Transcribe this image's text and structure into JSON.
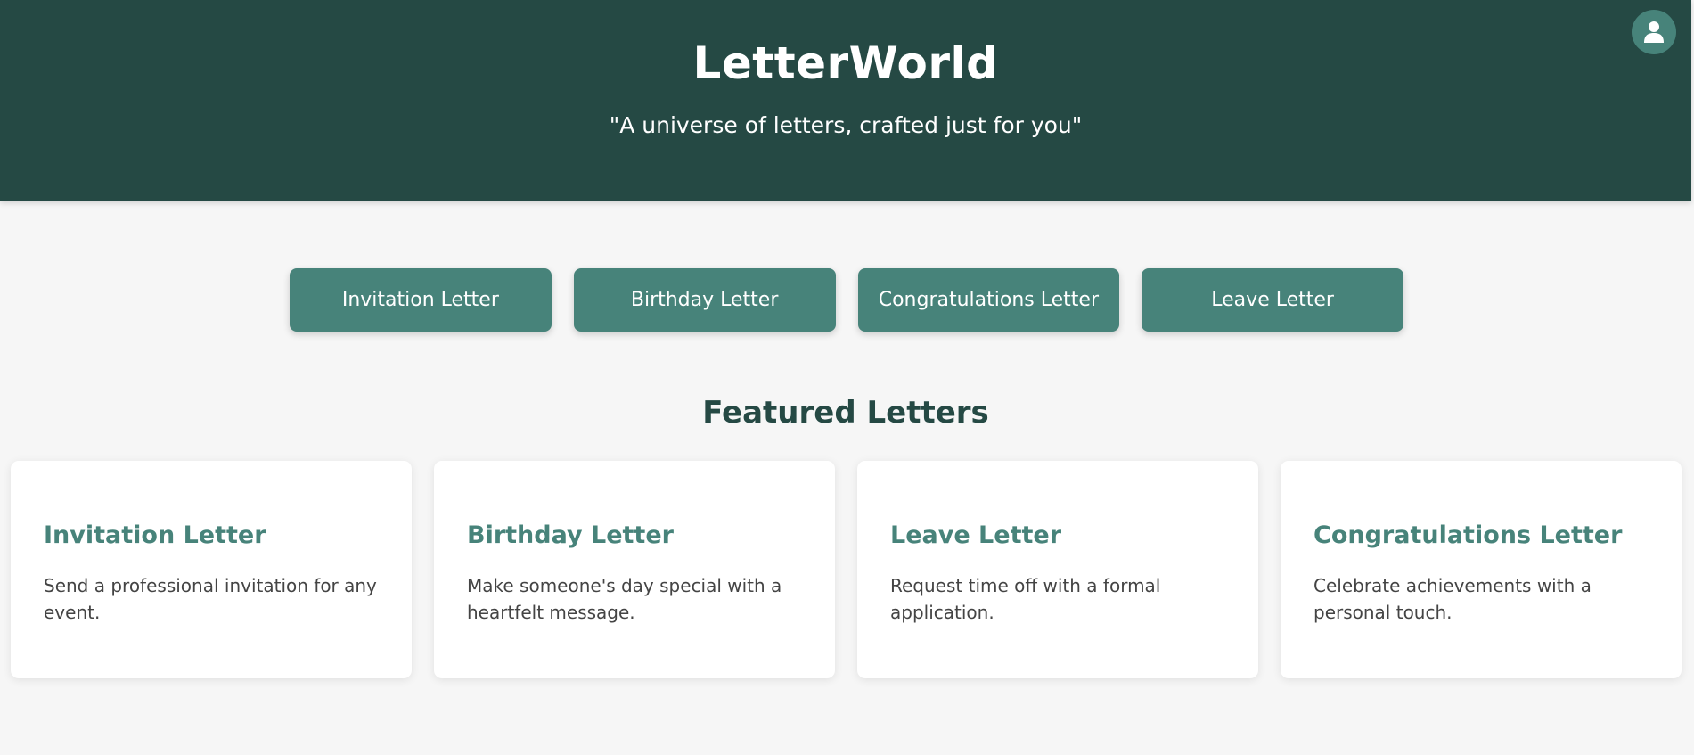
{
  "header": {
    "title": "LetterWorld",
    "tagline": "\"A universe of letters, crafted just for you\"",
    "profile_icon": "user-icon"
  },
  "nav": {
    "buttons": [
      {
        "label": "Invitation Letter"
      },
      {
        "label": "Birthday Letter"
      },
      {
        "label": "Congratulations Letter"
      },
      {
        "label": "Leave Letter"
      }
    ]
  },
  "featured": {
    "title": "Featured Letters",
    "cards": [
      {
        "title": "Invitation Letter",
        "description": "Send a professional invitation for any event."
      },
      {
        "title": "Birthday Letter",
        "description": "Make someone's day special with a heartfelt message."
      },
      {
        "title": "Leave Letter",
        "description": "Request time off with a formal application."
      },
      {
        "title": "Congratulations Letter",
        "description": "Celebrate achievements with a personal touch."
      }
    ]
  },
  "colors": {
    "header_bg": "#254944",
    "accent": "#47837a",
    "page_bg": "#f6f6f6",
    "card_bg": "#ffffff",
    "body_text": "#444444"
  }
}
